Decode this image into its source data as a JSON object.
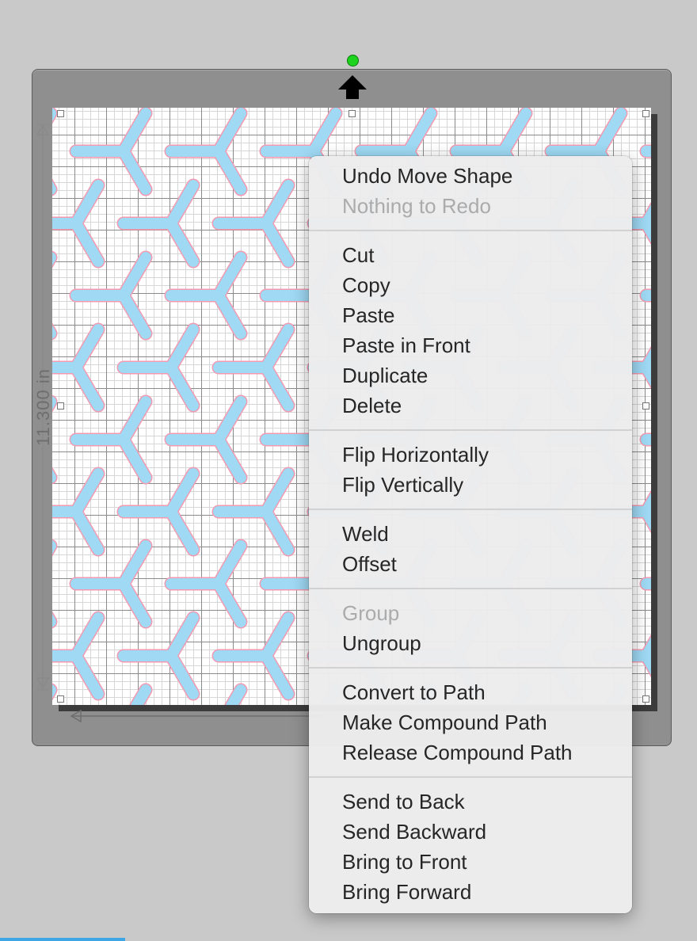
{
  "canvas": {
    "dimension_label": "11.300 in",
    "colors": {
      "mat": "#8f8f8f",
      "shape_fill": "#9fd9f4",
      "shape_outline": "#f39ab0",
      "rotate_handle": "#1dd31d"
    },
    "shape_name": "y-shape"
  },
  "context_menu": {
    "groups": [
      [
        {
          "label": "Undo Move Shape",
          "enabled": true
        },
        {
          "label": "Nothing to Redo",
          "enabled": false
        }
      ],
      [
        {
          "label": "Cut",
          "enabled": true
        },
        {
          "label": "Copy",
          "enabled": true
        },
        {
          "label": "Paste",
          "enabled": true
        },
        {
          "label": "Paste in Front",
          "enabled": true
        },
        {
          "label": "Duplicate",
          "enabled": true
        },
        {
          "label": "Delete",
          "enabled": true
        }
      ],
      [
        {
          "label": "Flip Horizontally",
          "enabled": true
        },
        {
          "label": "Flip Vertically",
          "enabled": true
        }
      ],
      [
        {
          "label": "Weld",
          "enabled": true
        },
        {
          "label": "Offset",
          "enabled": true
        }
      ],
      [
        {
          "label": "Group",
          "enabled": false
        },
        {
          "label": "Ungroup",
          "enabled": true
        }
      ],
      [
        {
          "label": "Convert to Path",
          "enabled": true
        },
        {
          "label": "Make Compound Path",
          "enabled": true
        },
        {
          "label": "Release Compound Path",
          "enabled": true
        }
      ],
      [
        {
          "label": "Send to Back",
          "enabled": true
        },
        {
          "label": "Send Backward",
          "enabled": true
        },
        {
          "label": "Bring to Front",
          "enabled": true
        },
        {
          "label": "Bring Forward",
          "enabled": true
        }
      ]
    ]
  }
}
